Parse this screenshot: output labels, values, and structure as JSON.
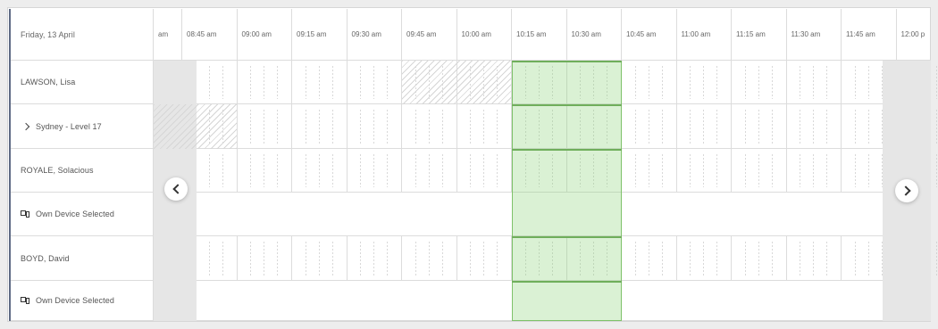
{
  "header": {
    "date_label": "Friday, 13 April",
    "time_slots": [
      "am",
      "08:45 am",
      "09:00 am",
      "09:15 am",
      "09:30 am",
      "09:45 am",
      "10:00 am",
      "10:15 am",
      "10:30 am",
      "10:45 am",
      "11:00 am",
      "11:15 am",
      "11:30 am",
      "11:45 am",
      "12:00 p"
    ]
  },
  "rows": [
    {
      "label": "LAWSON, Lisa",
      "kind": "person"
    },
    {
      "label": "Sydney - Level 17",
      "kind": "location",
      "icon": "chevron-right-icon"
    },
    {
      "label": "ROYALE, Solacious",
      "kind": "person"
    },
    {
      "label": "Own Device Selected",
      "kind": "device",
      "icon": "device-icon"
    },
    {
      "label": "BOYD, David",
      "kind": "person"
    },
    {
      "label": "Own Device Selected",
      "kind": "device",
      "icon": "device-icon"
    }
  ],
  "navigation": {
    "prev_icon": "chevron-left-icon",
    "next_icon": "chevron-right-icon"
  },
  "colors": {
    "selection_fill": "#d9f0d2",
    "selection_border": "#6fae5b",
    "unavailable": "#e6e6e6",
    "accent_bar": "#5e6a84"
  }
}
